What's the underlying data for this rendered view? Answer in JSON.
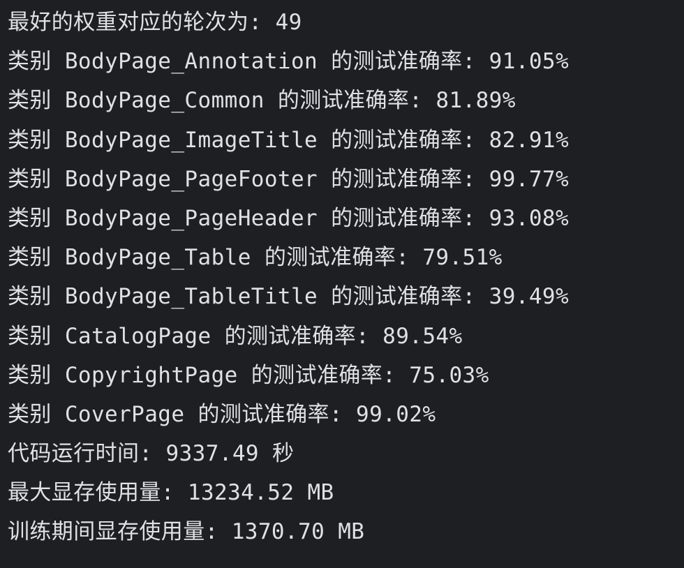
{
  "terminal": {
    "lines": [
      "最好的权重对应的轮次为: 49",
      "类别 BodyPage_Annotation 的测试准确率: 91.05%",
      "类别 BodyPage_Common 的测试准确率: 81.89%",
      "类别 BodyPage_ImageTitle 的测试准确率: 82.91%",
      "类别 BodyPage_PageFooter 的测试准确率: 99.77%",
      "类别 BodyPage_PageHeader 的测试准确率: 93.08%",
      "类别 BodyPage_Table 的测试准确率: 79.51%",
      "类别 BodyPage_TableTitle 的测试准确率: 39.49%",
      "类别 CatalogPage 的测试准确率: 89.54%",
      "类别 CopyrightPage 的测试准确率: 75.03%",
      "类别 CoverPage 的测试准确率: 99.02%",
      "代码运行时间: 9337.49 秒",
      "最大显存使用量: 13234.52 MB",
      "训练期间显存使用量: 1370.70 MB"
    ]
  },
  "colors": {
    "background": "#1e1f22",
    "text": "#dfe1e5"
  }
}
